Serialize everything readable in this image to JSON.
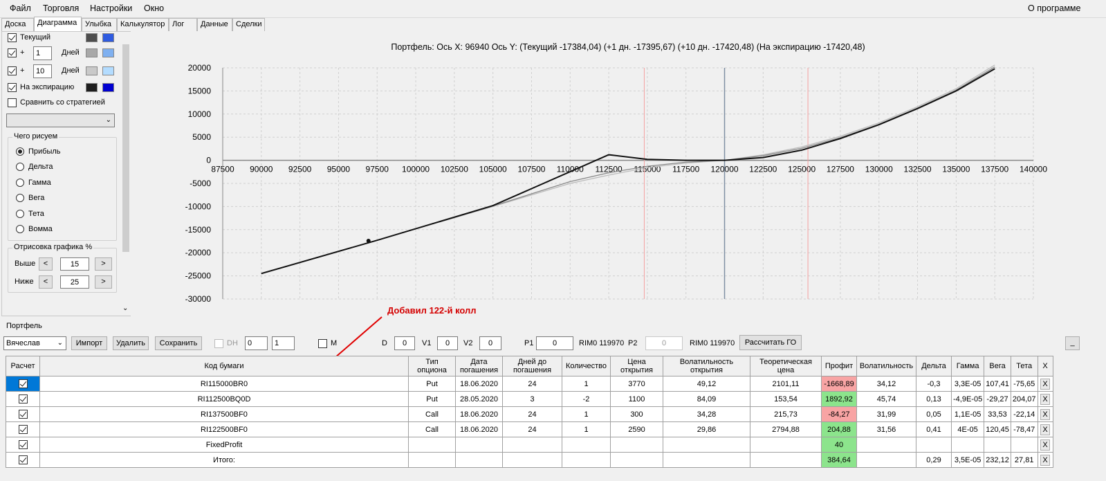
{
  "menu": {
    "file": "Файл",
    "trade": "Торговля",
    "settings": "Настройки",
    "window": "Окно",
    "about": "О программе"
  },
  "tabs": [
    "Доска",
    "Диаграмма",
    "Улыбка",
    "Калькулятор",
    "Лог",
    "Данные",
    "Сделки"
  ],
  "left": {
    "current_label": "Текущий",
    "plus1_sign": "+",
    "plus1_value": "1",
    "plus1_days": "Дней",
    "plus10_sign": "+",
    "plus10_value": "10",
    "plus10_days": "Дней",
    "expiry_label": "На экспирацию",
    "compare_label": "Сравнить со стратегией",
    "draw_group": "Чего рисуем",
    "radios": [
      "Прибыль",
      "Дельта",
      "Гамма",
      "Вега",
      "Тета",
      "Вомма"
    ],
    "render_group": "Отрисовка графика %",
    "above_label": "Выше",
    "above_value": "15",
    "below_label": "Ниже",
    "below_value": "25",
    "colors": {
      "current_dark": "#4d4d4d",
      "current_light": "#2f5be0",
      "p1_dark": "#a8a8a8",
      "p1_light": "#7fb0f0",
      "p10_dark": "#c9c9c9",
      "p10_light": "#b3dcff",
      "exp_dark": "#1e1e1e",
      "exp_light": "#0000d0"
    }
  },
  "chart_data": {
    "type": "line",
    "title": "Портфель: Ось X: 96940 Ось Y:  (Текущий -17384,04)  (+1 дн. -17395,67)  (+10 дн. -17420,48)  (На экспирацию -17420,48)",
    "xlim": [
      87500,
      140000
    ],
    "ylim": [
      -30000,
      20000
    ],
    "x_ticks": [
      "87500",
      "90000",
      "92500",
      "95000",
      "97500",
      "100000",
      "102500",
      "105000",
      "107500",
      "110000",
      "112500",
      "115000",
      "117500",
      "120000",
      "122500",
      "125000",
      "127500",
      "130000",
      "132500",
      "135000",
      "137500",
      "140000"
    ],
    "y_ticks": [
      "20000",
      "15000",
      "10000",
      "5000",
      "0",
      "-5000",
      "-10000",
      "-15000",
      "-20000",
      "-25000",
      "-30000"
    ],
    "grid": true,
    "vertical_lines": {
      "current_price": 120000,
      "marks": [
        114800,
        125400
      ]
    },
    "marker": {
      "x": 96940,
      "y": -17420
    },
    "series": [
      {
        "x": [
          90000,
          97500,
          105000,
          112500,
          115000,
          117500,
          120000,
          122500,
          125000,
          127500,
          130000,
          132500,
          135000,
          137500
        ],
        "y": [
          -24500,
          -17300,
          -9800,
          1200,
          200,
          0,
          0,
          600,
          2200,
          4700,
          7700,
          11200,
          15000,
          19800
        ]
      },
      {
        "x": [
          90000,
          97500,
          105000,
          110000,
          112500,
          115000,
          117500,
          120000,
          122500,
          125000,
          127500,
          130000,
          132500,
          135000,
          137500
        ],
        "y": [
          -24500,
          -17300,
          -9900,
          -4600,
          -2700,
          -1300,
          -400,
          0,
          1000,
          2600,
          4900,
          7800,
          11300,
          15200,
          20200
        ]
      },
      {
        "x": [
          90000,
          97500,
          105000,
          110000,
          112500,
          115000,
          117500,
          120000,
          122500,
          125000,
          127500,
          130000,
          132500,
          135000,
          137500
        ],
        "y": [
          -24500,
          -17300,
          -10000,
          -5000,
          -3200,
          -1600,
          -600,
          0,
          1200,
          2900,
          5200,
          8100,
          11600,
          15500,
          20600
        ]
      }
    ],
    "colors": [
      "#111111",
      "#888888",
      "#bbbbbb"
    ]
  },
  "annotation": "Добавил 122-й колл",
  "portfolio": {
    "label": "Портфель",
    "account": "Вячеслав",
    "import": "Импорт",
    "delete": "Удалить",
    "save": "Сохранить",
    "dh": "DH",
    "dh_v1": "0",
    "dh_v2": "1",
    "m": "M",
    "d_label": "D",
    "d_value": "0",
    "v1_label": "V1",
    "v1_value": "0",
    "v2_label": "V2",
    "v2_value": "0",
    "p1_label": "P1",
    "p1_value": "0",
    "rim1": "RIM0 119970",
    "p2_label": "P2",
    "p2_value": "0",
    "rim2": "RIM0 119970",
    "calc_go": "Рассчитать ГО",
    "minimize": "_"
  },
  "table": {
    "headers": [
      "Расчет",
      "Код бумаги",
      "Тип опциона",
      "Дата погашения",
      "Дней до погашения",
      "Количество",
      "Цена открытия",
      "Волатильность открытия",
      "Теоретическая цена",
      "Профит",
      "Волатильность",
      "Дельта",
      "Гамма",
      "Вега",
      "Тета",
      "X"
    ],
    "rows": [
      [
        "RI115000BR0",
        "Put",
        "18.06.2020",
        "24",
        "1",
        "3770",
        "49,12",
        "2101,11",
        "-1668,89",
        "34,12",
        "-0,3",
        "3,3E-05",
        "107,41",
        "-75,65",
        "X"
      ],
      [
        "RI112500BQ0D",
        "Put",
        "28.05.2020",
        "3",
        "-2",
        "1100",
        "84,09",
        "153,54",
        "1892,92",
        "45,74",
        "0,13",
        "-4,9E-05",
        "-29,27",
        "204,07",
        "X"
      ],
      [
        "RI137500BF0",
        "Call",
        "18.06.2020",
        "24",
        "1",
        "300",
        "34,28",
        "215,73",
        "-84,27",
        "31,99",
        "0,05",
        "1,1E-05",
        "33,53",
        "-22,14",
        "X"
      ],
      [
        "RI122500BF0",
        "Call",
        "18.06.2020",
        "24",
        "1",
        "2590",
        "29,86",
        "2794,88",
        "204,88",
        "31,56",
        "0,41",
        "4E-05",
        "120,45",
        "-78,47",
        "X"
      ],
      [
        "FixedProfit",
        "",
        "",
        "",
        "",
        "",
        "",
        "",
        "40",
        "",
        "",
        "",
        "",
        "",
        "X"
      ],
      [
        "Итого:",
        "",
        "",
        "",
        "",
        "",
        "",
        "",
        "384,64",
        "",
        "0,29",
        "3,5E-05",
        "232,12",
        "27,81",
        "X"
      ]
    ]
  }
}
